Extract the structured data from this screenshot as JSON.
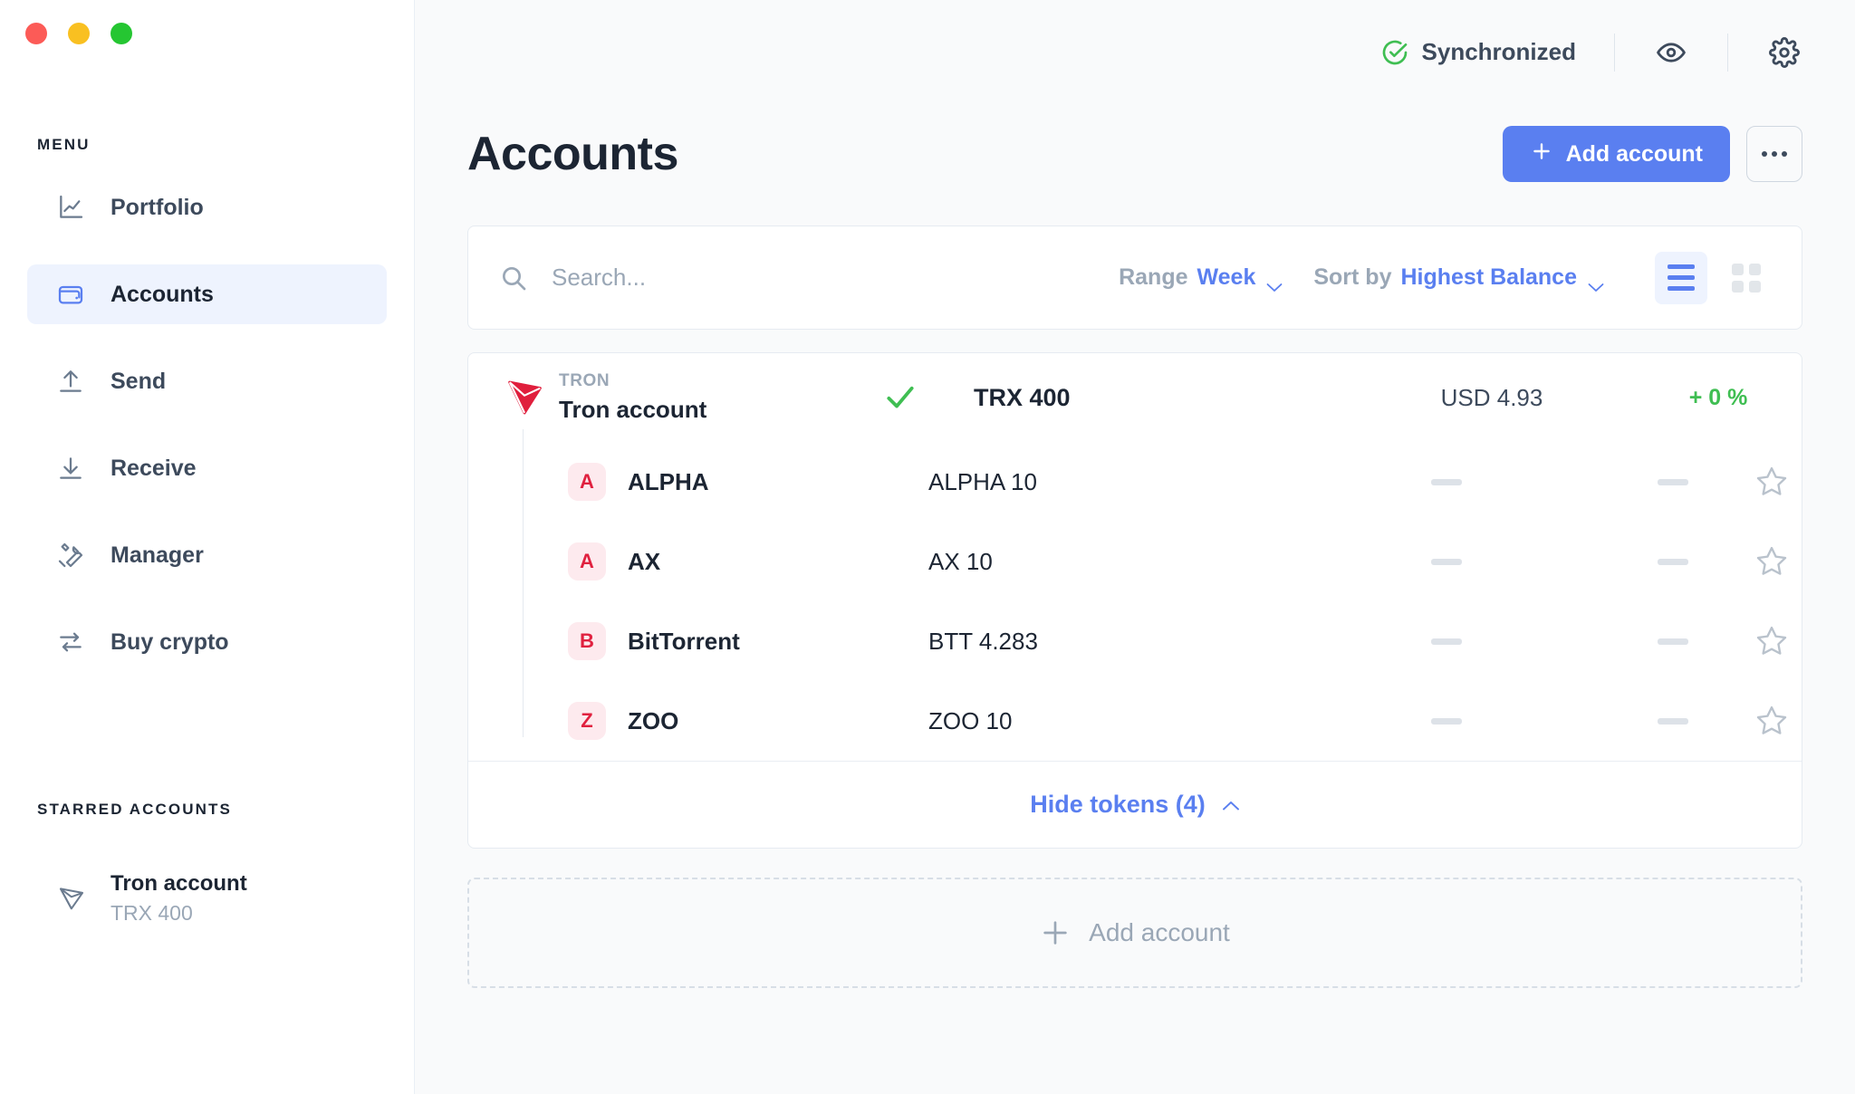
{
  "window": {
    "traffic_lights": [
      "close",
      "minimize",
      "maximize"
    ],
    "colors": {
      "close": "#fc5b57",
      "minimize": "#f9c021",
      "maximize": "#25c632"
    }
  },
  "sidebar": {
    "menu_label": "MENU",
    "items": [
      {
        "label": "Portfolio",
        "icon": "chart-line-icon",
        "active": false
      },
      {
        "label": "Accounts",
        "icon": "wallet-icon",
        "active": true
      },
      {
        "label": "Send",
        "icon": "arrow-up-icon",
        "active": false
      },
      {
        "label": "Receive",
        "icon": "arrow-down-icon",
        "active": false
      },
      {
        "label": "Manager",
        "icon": "tools-icon",
        "active": false
      },
      {
        "label": "Buy crypto",
        "icon": "swap-arrows-icon",
        "active": false
      }
    ],
    "starred_label": "STARRED ACCOUNTS",
    "starred": [
      {
        "name": "Tron account",
        "balance": "TRX 400",
        "icon": "tron-icon"
      }
    ]
  },
  "topbar": {
    "sync_status": "Synchronized",
    "sync_icon": "check-circle-icon",
    "eye_icon": "eye-icon",
    "settings_icon": "gear-icon"
  },
  "header": {
    "title": "Accounts",
    "add_account_label": "Add account",
    "more_icon": "ellipsis-icon",
    "accent_color": "#5a7ff0"
  },
  "toolbar": {
    "search_placeholder": "Search...",
    "search_value": "",
    "search_icon": "search-icon",
    "range_label": "Range",
    "range_value": "Week",
    "sort_label": "Sort by",
    "sort_value": "Highest Balance",
    "view_list_icon": "list-view-icon",
    "view_grid_icon": "grid-view-icon",
    "active_view": "list"
  },
  "account": {
    "currency_ticker": "TRON",
    "name": "Tron account",
    "logo_icon": "tron-logo-icon",
    "verified_icon": "check-icon",
    "amount": "TRX 400",
    "countervalue": "USD 4.93",
    "change": "+ 0 %",
    "change_color": "#3fbe52",
    "starred": true,
    "star_icon": "star-filled-icon"
  },
  "tokens": [
    {
      "badge": "A",
      "name": "ALPHA",
      "amount": "ALPHA 10",
      "countervalue": "—",
      "change": "—",
      "starred": false,
      "star_icon": "star-outline-icon"
    },
    {
      "badge": "A",
      "name": "AX",
      "amount": "AX 10",
      "countervalue": "—",
      "change": "—",
      "starred": false,
      "star_icon": "star-outline-icon"
    },
    {
      "badge": "B",
      "name": "BitTorrent",
      "amount": "BTT 4.283",
      "countervalue": "—",
      "change": "—",
      "starred": false,
      "star_icon": "star-outline-icon"
    },
    {
      "badge": "Z",
      "name": "ZOO",
      "amount": "ZOO 10",
      "countervalue": "—",
      "change": "—",
      "starred": false,
      "star_icon": "star-outline-icon"
    }
  ],
  "card_footer": {
    "hide_tokens_label": "Hide tokens (4)",
    "chevron_icon": "chevron-up-icon"
  },
  "add_placeholder": {
    "label": "Add account",
    "icon": "plus-icon"
  }
}
